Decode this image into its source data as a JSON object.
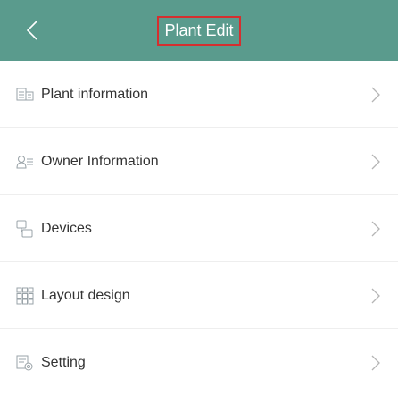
{
  "header": {
    "title": "Plant Edit",
    "background": "#5a9b8d",
    "back_icon": "chevron-left-icon",
    "title_highlight": "#d52f2f"
  },
  "menu": {
    "items": [
      {
        "label": "Plant information",
        "icon": "plant-info-icon"
      },
      {
        "label": "Owner Information",
        "icon": "owner-info-icon"
      },
      {
        "label": "Devices",
        "icon": "devices-icon"
      },
      {
        "label": "Layout design",
        "icon": "layout-grid-icon"
      },
      {
        "label": "Setting",
        "icon": "settings-icon"
      }
    ],
    "chevron_icon": "chevron-right-icon"
  }
}
